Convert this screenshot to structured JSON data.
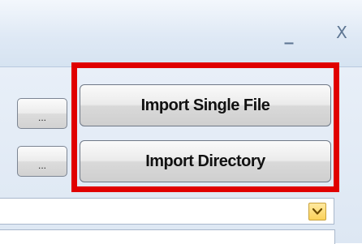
{
  "window": {
    "minimize_label": "_",
    "close_label": "X"
  },
  "browse_buttons": {
    "file_label": "...",
    "directory_label": "..."
  },
  "import_buttons": {
    "single_file_label": "Import Single File",
    "directory_label": "Import Directory"
  },
  "dropdown": {
    "icon": "chevron-down-icon"
  },
  "colors": {
    "highlight": "#e00000",
    "panel": "#dfe8f4",
    "dropdown_arrow": "#fbd25a"
  }
}
